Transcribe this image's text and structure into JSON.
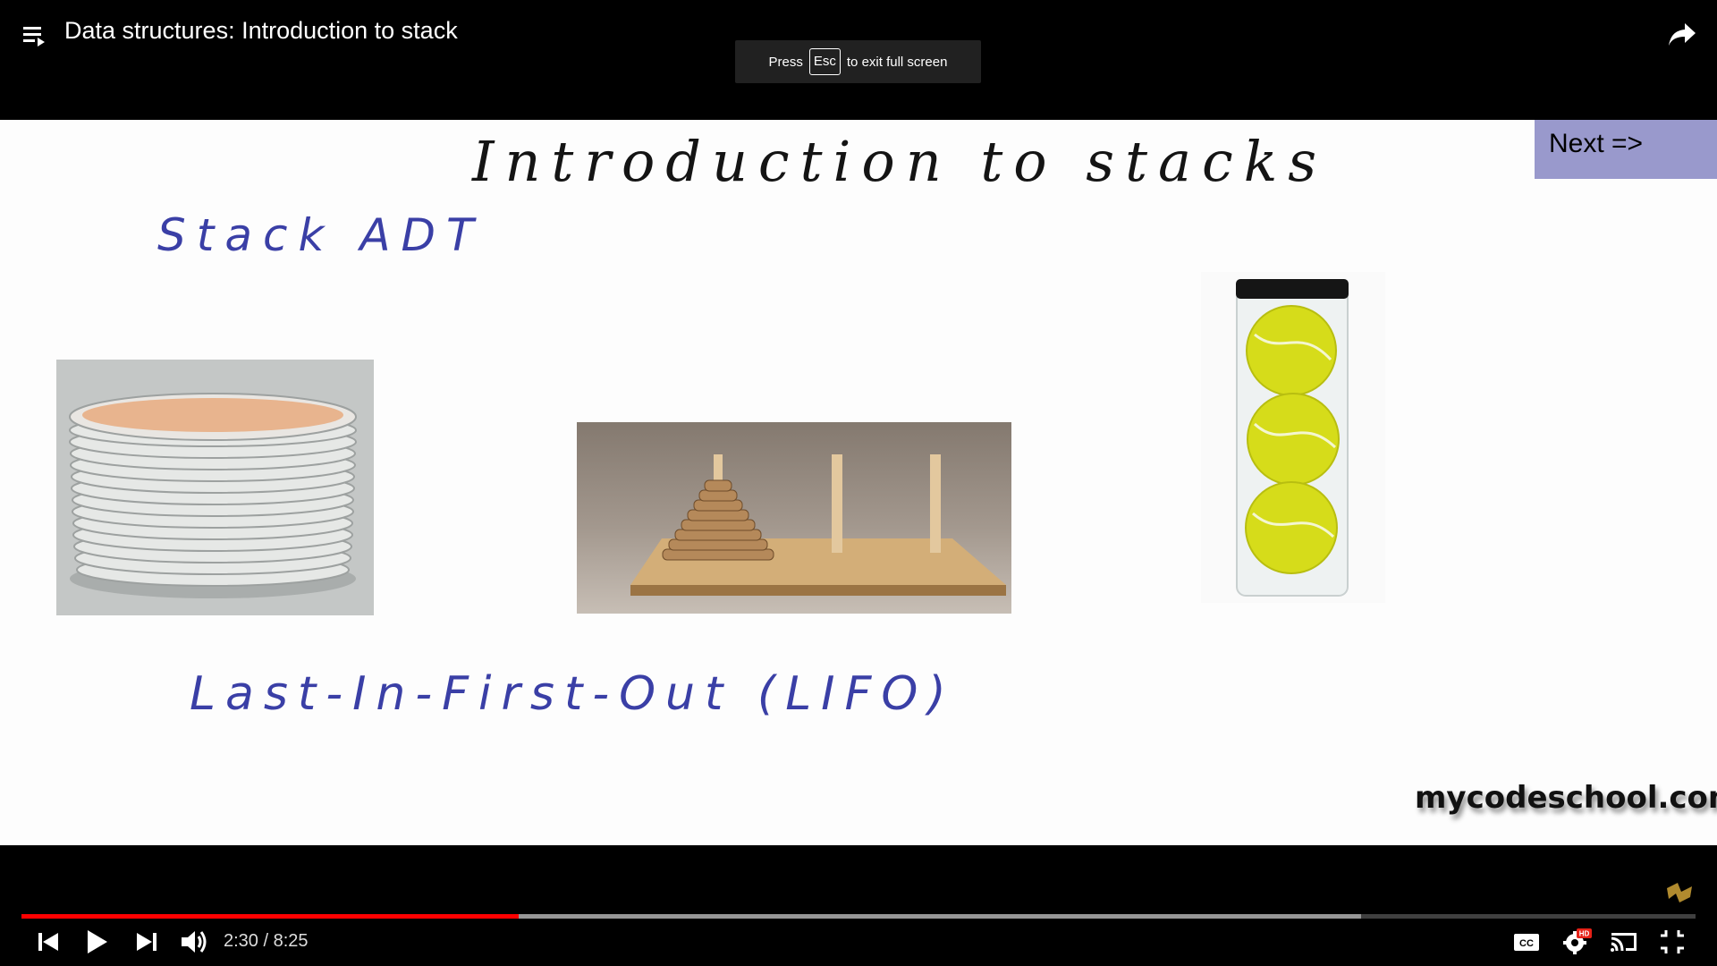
{
  "header": {
    "title": "Data structures: Introduction to stack",
    "playlist_icon": "playlist-icon",
    "share_icon": "share-arrow-icon"
  },
  "fullscreen_toast": {
    "press": "Press",
    "key": "Esc",
    "message": "to exit full screen"
  },
  "slide": {
    "title": "Introduction to stacks",
    "next_label": "Next =>",
    "subtitle": "Stack ADT",
    "lifo": "Last-In-First-Out (LIFO)",
    "watermark": "mycodeschool.com",
    "images": [
      "stack-of-plates",
      "tower-of-hanoi",
      "tennis-ball-tube"
    ]
  },
  "controls": {
    "time": "2:30 / 8:25",
    "progress_fraction": 0.297,
    "buffer_fraction": 0.8,
    "colors": {
      "played": "#ff0000",
      "next_button": "#9999cc",
      "handwriting": "#3a3fa6"
    },
    "icons": [
      "previous-icon",
      "play-icon",
      "next-icon",
      "volume-icon",
      "captions-icon",
      "settings-hd-icon",
      "cast-icon",
      "exit-fullscreen-icon"
    ]
  }
}
